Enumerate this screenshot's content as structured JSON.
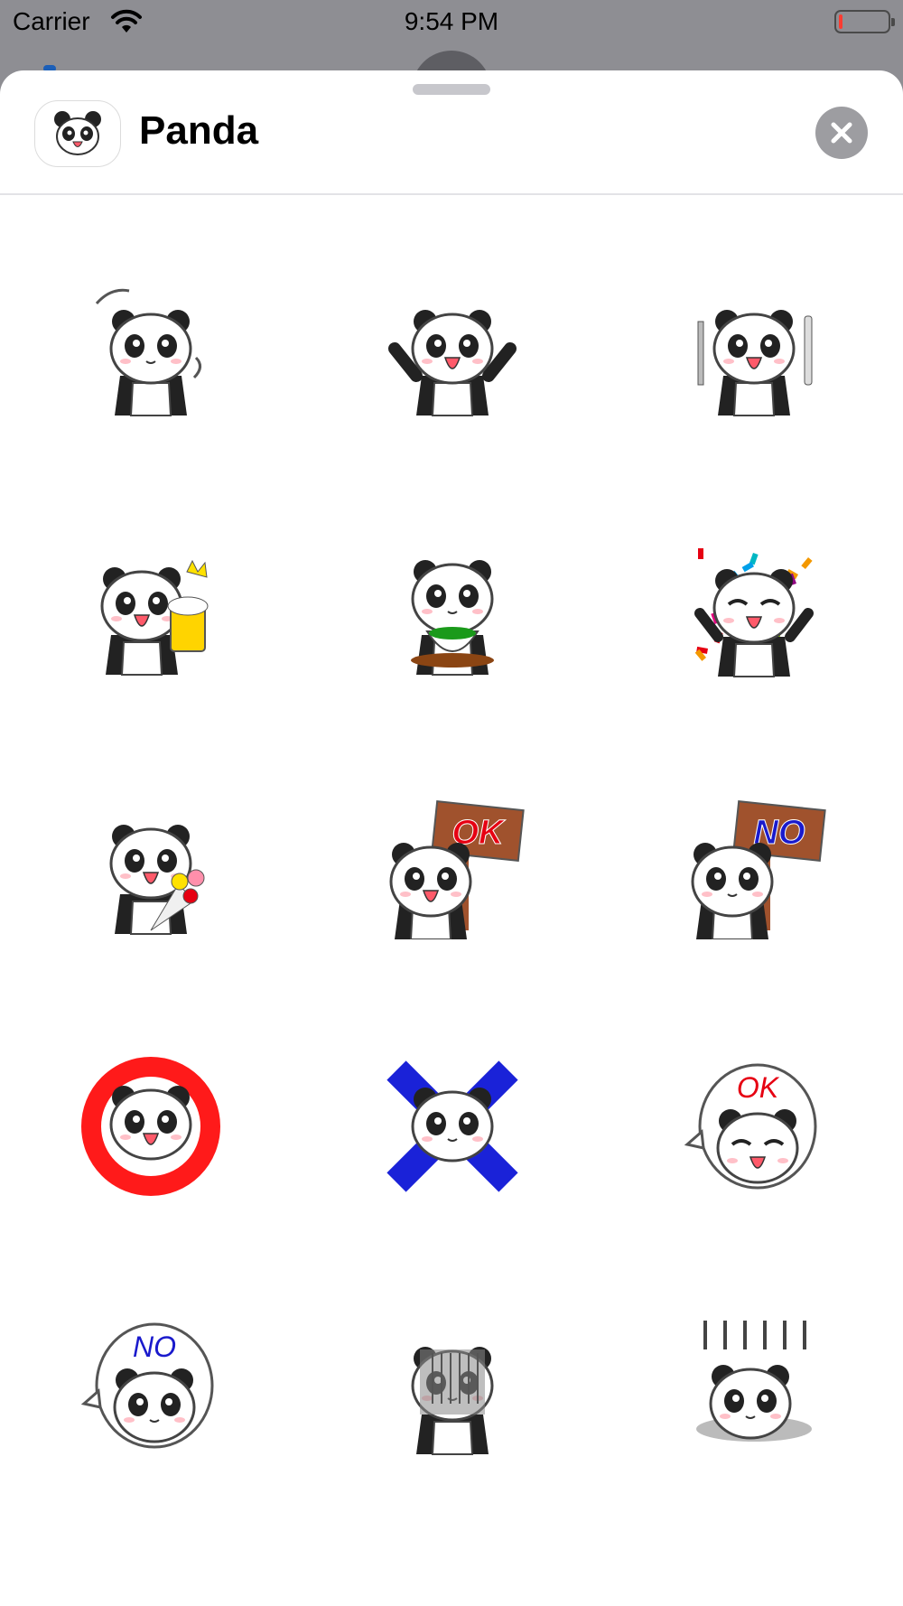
{
  "status_bar": {
    "carrier": "Carrier",
    "time": "9:54 PM",
    "battery_level": 0.08,
    "battery_color": "#ff3b30"
  },
  "sheet": {
    "app_title": "Panda",
    "app_icon": "panda-face-icon",
    "close_icon": "close-icon"
  },
  "stickers": [
    {
      "name": "sticker-panda-waving",
      "icon": "panda-waving"
    },
    {
      "name": "sticker-panda-cheering",
      "icon": "panda-cheering"
    },
    {
      "name": "sticker-panda-fork-knife",
      "icon": "panda-fork-knife"
    },
    {
      "name": "sticker-panda-beer",
      "icon": "panda-beer"
    },
    {
      "name": "sticker-panda-tea",
      "icon": "panda-tea"
    },
    {
      "name": "sticker-panda-confetti",
      "icon": "panda-confetti"
    },
    {
      "name": "sticker-panda-bouquet",
      "icon": "panda-bouquet"
    },
    {
      "name": "sticker-panda-ok-sign",
      "icon": "panda-sign",
      "text": "OK"
    },
    {
      "name": "sticker-panda-no-sign",
      "icon": "panda-sign",
      "text": "NO"
    },
    {
      "name": "sticker-panda-circle",
      "icon": "panda-circle"
    },
    {
      "name": "sticker-panda-cross",
      "icon": "panda-cross"
    },
    {
      "name": "sticker-panda-ok-bubble",
      "icon": "panda-bubble",
      "text": "OK"
    },
    {
      "name": "sticker-panda-no-bubble",
      "icon": "panda-bubble",
      "text": "NO"
    },
    {
      "name": "sticker-panda-gloomy",
      "icon": "panda-gloomy"
    },
    {
      "name": "sticker-panda-fallen",
      "icon": "panda-fallen"
    }
  ],
  "colors": {
    "sign_ok": "#e60012",
    "sign_no": "#1a1acc",
    "circle": "#ff1a1a",
    "cross": "#1a22d8",
    "board": "#a0522d"
  }
}
